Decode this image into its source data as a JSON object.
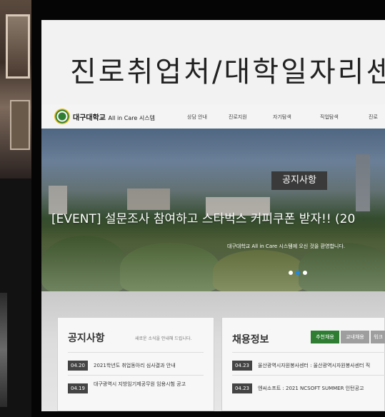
{
  "screen_title": "진로취업처/대학일자리센",
  "logo": {
    "name": "대구대학교",
    "sub": "All in Care 시스템"
  },
  "nav": [
    {
      "label": "상담 안내"
    },
    {
      "label": "진로지원"
    },
    {
      "label": "자기탐색"
    },
    {
      "label": "직업탐색"
    },
    {
      "label": "진로"
    }
  ],
  "hero": {
    "badge": "공지사항",
    "headline": "[EVENT] 설문조사 참여하고 스타벅스 커피쿠폰 받자!! (20",
    "sub": "대구대학교 All in Care 시스템에 오신 것을 환영합니다.",
    "slides": 3,
    "active_slide": 2
  },
  "notice": {
    "title": "공지사항",
    "subtitle": "새로운 소식을 안내해 드립니다.",
    "items": [
      {
        "date": "04.20",
        "text": "2021학년도 취업동아리 심사결과 안내"
      },
      {
        "date": "04.19",
        "text": "대구광역시 지방임기제공무원 임용시험 공고"
      }
    ]
  },
  "jobs": {
    "title": "채용정보",
    "tabs": [
      {
        "label": "추천채용",
        "active": true
      },
      {
        "label": "교내채용",
        "active": false
      },
      {
        "label": "워크",
        "active": false
      }
    ],
    "items": [
      {
        "date": "04.23",
        "text": "울산광역시자원봉사센터 : 울산광역시자원봉사센터 직"
      },
      {
        "date": "04.23",
        "text": "엔씨소프트 : 2021 NCSOFT SUMMER 인턴공고"
      }
    ]
  },
  "colors": {
    "accent": "#2e7d32",
    "date_bg": "#444444",
    "dot_active": "#1e88e5"
  }
}
